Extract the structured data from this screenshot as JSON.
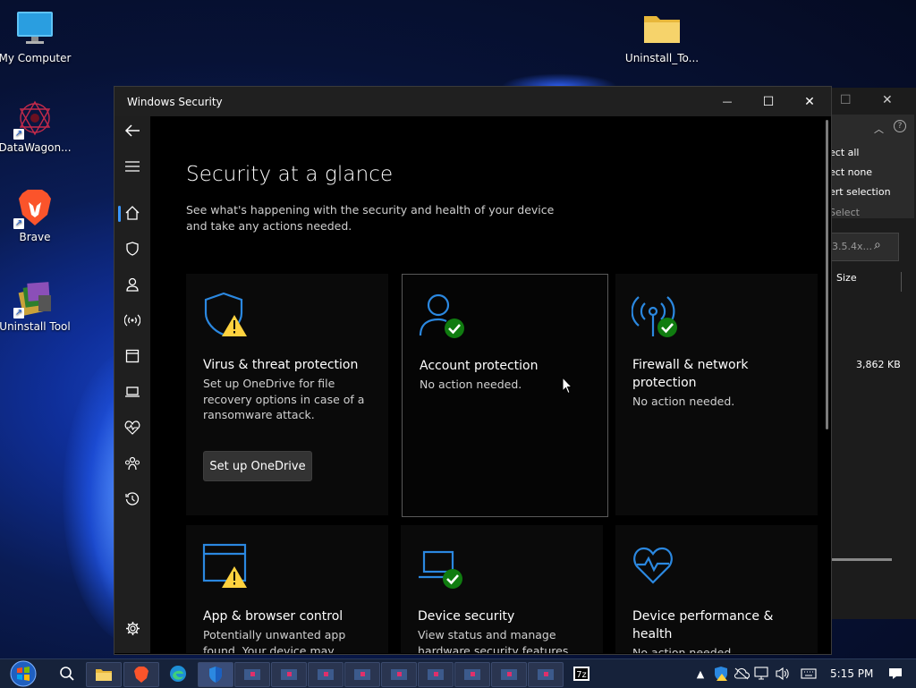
{
  "desktop": {
    "icons": [
      {
        "label": "My Computer"
      },
      {
        "label": "DataWagon..."
      },
      {
        "label": "Brave"
      },
      {
        "label": "Uninstall Tool"
      },
      {
        "label": "Uninstall_To..."
      }
    ]
  },
  "explorer": {
    "menu": [
      "ect all",
      "ect none",
      "ert selection",
      "Select"
    ],
    "search_placeholder": "3.5.4x...",
    "size_header": "Size",
    "size_value": "3,862 KB"
  },
  "window": {
    "title": "Windows Security",
    "minimize": "—",
    "maximize": "☐",
    "close": "✕",
    "heading": "Security at a glance",
    "subtitle": "See what's happening with the security and health of your device and take any actions needed.",
    "cards": [
      {
        "title": "Virus & threat protection",
        "desc": "Set up OneDrive for file recovery options in case of a ransomware attack.",
        "button": "Set up OneDrive",
        "status": "warning",
        "icon": "shield-icon"
      },
      {
        "title": "Account protection",
        "desc": "No action needed.",
        "status": "ok",
        "icon": "person-icon"
      },
      {
        "title": "Firewall & network protection",
        "desc": "No action needed.",
        "status": "ok",
        "icon": "wifi-antenna-icon"
      },
      {
        "title": "App & browser control",
        "desc": "Potentially unwanted app found. Your device may perform poorly.",
        "status": "warning",
        "icon": "browser-window-icon"
      },
      {
        "title": "Device security",
        "desc": "View status and manage hardware security features.",
        "status": "ok",
        "icon": "laptop-icon"
      },
      {
        "title": "Device performance & health",
        "desc": "No action needed.",
        "status": "none",
        "icon": "heart-pulse-icon"
      }
    ]
  },
  "taskbar": {
    "time": "5:15 PM"
  },
  "colors": {
    "accent": "#3a96ff",
    "ok": "#107c10",
    "warning": "#ffd23f"
  }
}
